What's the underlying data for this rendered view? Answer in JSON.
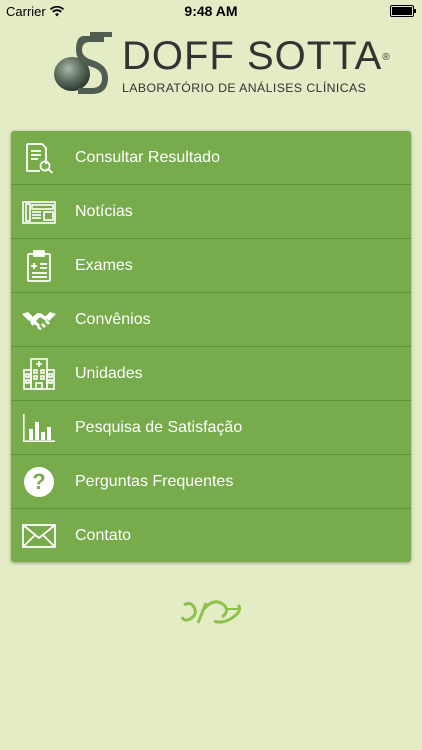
{
  "status_bar": {
    "carrier": "Carrier",
    "time": "9:48 AM"
  },
  "logo": {
    "name": "DOFF SOTTA",
    "registered": "®",
    "tagline": "LABORATÓRIO DE ANÁLISES CLÍNICAS"
  },
  "menu": {
    "items": [
      {
        "label": "Consultar Resultado",
        "icon": "document-search-icon"
      },
      {
        "label": "Notícias",
        "icon": "newspaper-icon"
      },
      {
        "label": "Exames",
        "icon": "clipboard-icon"
      },
      {
        "label": "Convênios",
        "icon": "handshake-icon"
      },
      {
        "label": "Unidades",
        "icon": "hospital-building-icon"
      },
      {
        "label": "Pesquisa de Satisfação",
        "icon": "bar-chart-icon"
      },
      {
        "label": "Perguntas Frequentes",
        "icon": "question-icon"
      },
      {
        "label": "Contato",
        "icon": "envelope-icon"
      }
    ],
    "mini_newspaper_text": "Notícias"
  },
  "colors": {
    "background": "#e3ecc4",
    "menu": "#77ab4c",
    "divider": "#5f8e3a",
    "footer_logo": "#8bc34a"
  }
}
